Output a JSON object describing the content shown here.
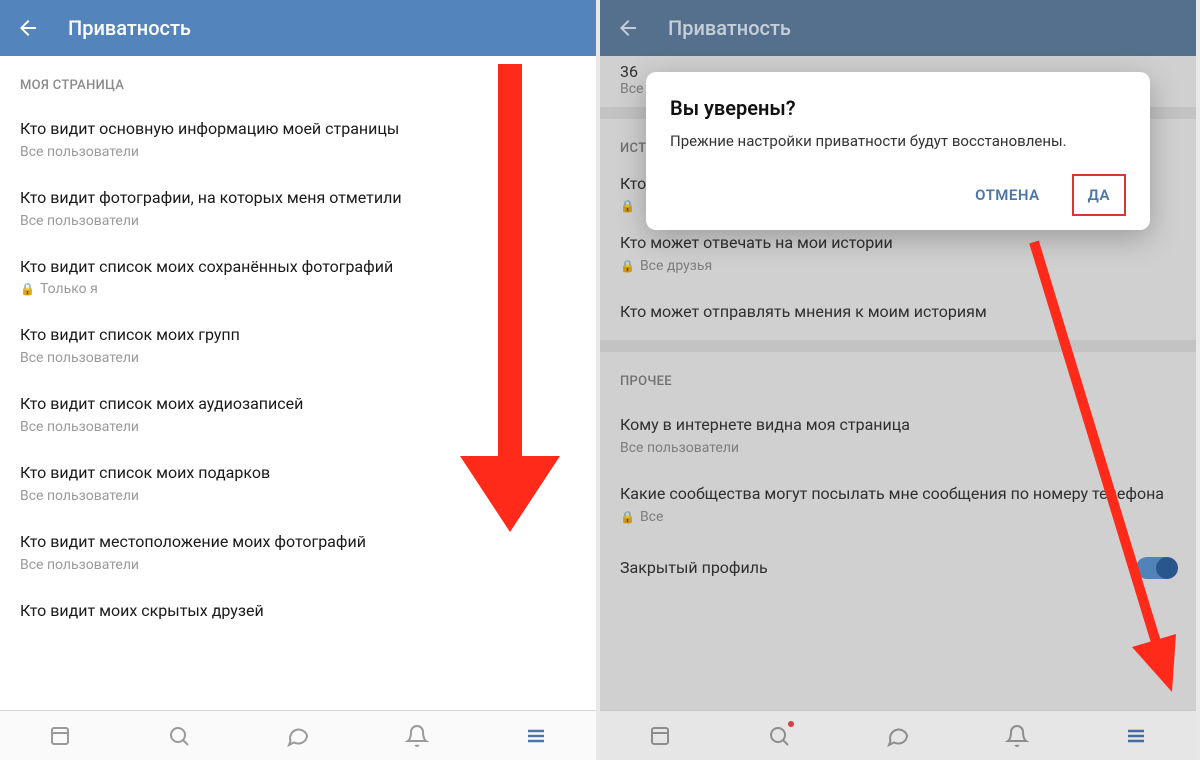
{
  "left": {
    "header_title": "Приватность",
    "section": "МОЯ СТРАНИЦА",
    "items": [
      {
        "title": "Кто видит основную информацию моей страницы",
        "sub": "Все пользователи",
        "locked": false
      },
      {
        "title": "Кто видит фотографии, на которых меня отметили",
        "sub": "Все пользователи",
        "locked": false
      },
      {
        "title": "Кто видит список моих сохранённых фотографий",
        "sub": "Только я",
        "locked": true
      },
      {
        "title": "Кто видит список моих групп",
        "sub": "Все пользователи",
        "locked": false
      },
      {
        "title": "Кто видит список моих аудиозаписей",
        "sub": "Все пользователи",
        "locked": false
      },
      {
        "title": "Кто видит список моих подарков",
        "sub": "Все пользователи",
        "locked": false
      },
      {
        "title": "Кто видит местоположение моих фотографий",
        "sub": "Все пользователи",
        "locked": false
      },
      {
        "title": "Кто видит моих скрытых друзей",
        "sub": "",
        "locked": false
      }
    ]
  },
  "right": {
    "header_title": "Приватность",
    "top_fragment": {
      "num": "36",
      "sub": "Все"
    },
    "section_stories": "ИСТО",
    "item_partial": "Кто",
    "stories_items": [
      {
        "title": "Кто может отвечать на мои истории",
        "sub": "Все друзья",
        "locked": true
      },
      {
        "title": "Кто может отправлять мнения к моим историям",
        "sub": "",
        "locked": false
      }
    ],
    "section_other": "ПРОЧЕЕ",
    "other_items": [
      {
        "title": "Кому в интернете видна моя страница",
        "sub": "Все пользователи",
        "locked": false
      },
      {
        "title": "Какие сообщества могут посылать мне сообщения по номеру телефона",
        "sub": "Все",
        "locked": true
      }
    ],
    "toggle_label": "Закрытый профиль",
    "toggle_on": true,
    "dialog": {
      "title": "Вы уверены?",
      "message": "Прежние настройки приватности будут восстановлены.",
      "cancel": "ОТМЕНА",
      "confirm": "ДА"
    }
  },
  "colors": {
    "header": "#5484bc",
    "accent": "#4a76a8",
    "arrow": "#ff2a1a"
  }
}
